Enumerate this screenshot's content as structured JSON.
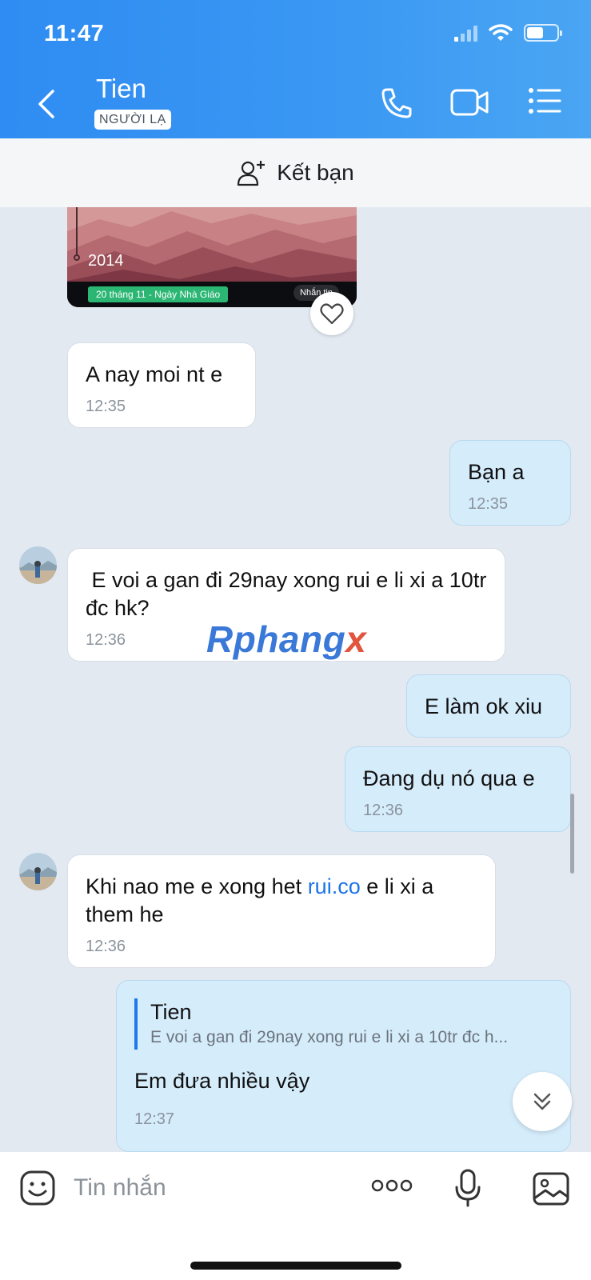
{
  "status_bar": {
    "time": "11:47"
  },
  "header": {
    "name": "Tien",
    "badge": "NGƯỜI LẠ"
  },
  "friend_bar": {
    "label": "Kết bạn"
  },
  "shared_card": {
    "year": "2014",
    "tag": "20 tháng 11 - Ngày Nhà Giáo",
    "reply": "Nhắn tin"
  },
  "messages": [
    {
      "direction": "in",
      "text": "A nay moi nt e",
      "time": "12:35"
    },
    {
      "direction": "out",
      "text": "Bạn a",
      "time": "12:35"
    },
    {
      "direction": "in",
      "text": " E voi a gan đi 29nay xong rui e li xi a 10tr đc hk?",
      "time": "12:36"
    },
    {
      "direction": "out",
      "text": "E làm ok xiu"
    },
    {
      "direction": "out",
      "text": "Đang dụ nó qua e",
      "time": "12:36"
    },
    {
      "direction": "in",
      "text_before": "Khi nao me e xong het ",
      "link": "rui.co",
      "text_after": " e li xi a them he",
      "time": "12:36"
    },
    {
      "direction": "out",
      "quote_name": "Tien",
      "quote_text": "E voi a gan đi 29nay xong rui e li xi a 10tr đc h...",
      "text": "Em đưa nhiều vậy",
      "time": "12:37"
    }
  ],
  "watermark": {
    "main": "Rphang",
    "accent": "x"
  },
  "input": {
    "placeholder": "Tin nhắn"
  }
}
